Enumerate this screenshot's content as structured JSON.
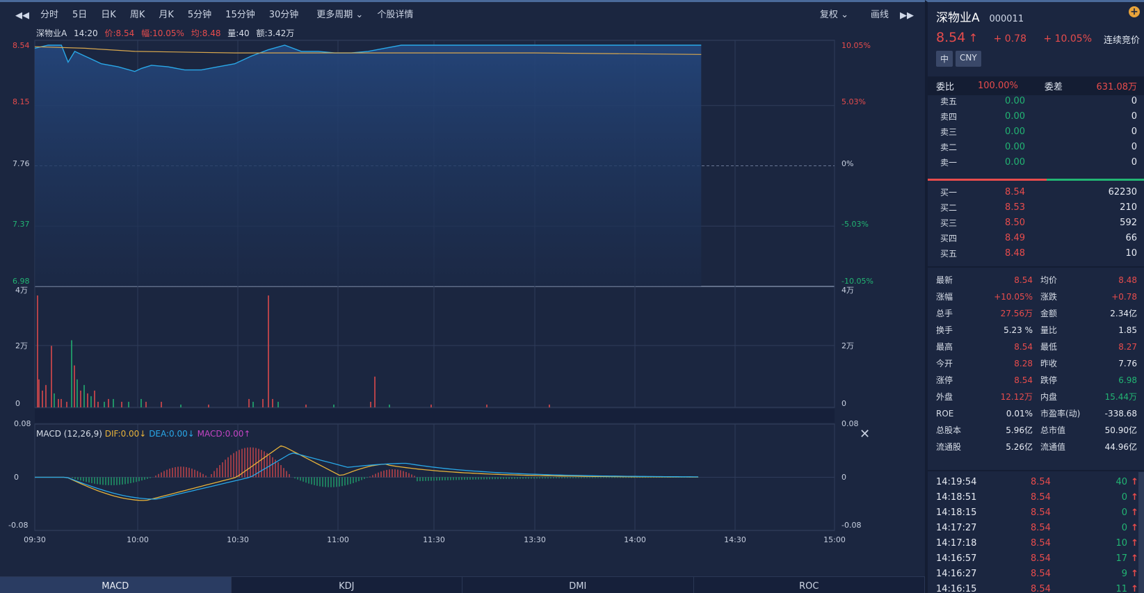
{
  "toolbar": {
    "prev_icon": "double-left-arrow",
    "items": [
      "分时",
      "5日",
      "日K",
      "周K",
      "月K",
      "5分钟",
      "15分钟",
      "30分钟",
      "更多周期",
      "个股详情"
    ],
    "active_index": 0,
    "fuquan": "复权",
    "draw": "画线",
    "next_icon": "double-right-arrow"
  },
  "info": {
    "name": "深物业A",
    "time": "14:20",
    "price": "价:8.54",
    "range": "幅:10.05%",
    "avg": "均:8.48",
    "vol": "量:40",
    "amount": "额:3.42万"
  },
  "axes": {
    "price_left": [
      "8.54",
      "8.15",
      "7.76",
      "7.37",
      "6.98"
    ],
    "pct_right": [
      "10.05%",
      "5.03%",
      "0%",
      "-5.03%",
      "-10.05%"
    ],
    "vol_left": [
      "4万",
      "2万",
      "0"
    ],
    "vol_right": [
      "4万",
      "2万",
      "0"
    ],
    "macd_left": [
      "0.08",
      "0",
      "-0.08"
    ],
    "macd_right": [
      "0.08",
      "0",
      "-0.08"
    ],
    "time": [
      "09:30",
      "10:00",
      "10:30",
      "11:00",
      "11:30",
      "13:30",
      "14:00",
      "14:30",
      "15:00"
    ]
  },
  "macd": {
    "title": "MACD (12,26,9)",
    "dif": "DIF:0.00↓",
    "dea": "DEA:0.00↓",
    "macd": "MACD:0.00↑",
    "close_icon": "close-icon"
  },
  "bottom_tabs": [
    "MACD",
    "KDJ",
    "DMI",
    "ROC"
  ],
  "colors": {
    "up": "#e84c4c",
    "down": "#22b573",
    "price_line": "#29a8e8",
    "avg_line": "#d9a84e",
    "macd_purple": "#c445c4"
  },
  "panel": {
    "name": "深物业A",
    "code": "000011",
    "price": "8.54",
    "arrow": "↑",
    "change": "+ 0.78",
    "change_pct": "+ 10.05%",
    "mode": "连续竞价",
    "badges": [
      "中",
      "CNY"
    ],
    "weibi_label": "委比",
    "weibi": "100.00%",
    "weicha_label": "委差",
    "weicha": "631.08万",
    "sell": [
      {
        "label": "卖五",
        "price": "0.00",
        "vol": "0"
      },
      {
        "label": "卖四",
        "price": "0.00",
        "vol": "0"
      },
      {
        "label": "卖三",
        "price": "0.00",
        "vol": "0"
      },
      {
        "label": "卖二",
        "price": "0.00",
        "vol": "0"
      },
      {
        "label": "卖一",
        "price": "0.00",
        "vol": "0"
      }
    ],
    "buy": [
      {
        "label": "买一",
        "price": "8.54",
        "vol": "62230"
      },
      {
        "label": "买二",
        "price": "8.53",
        "vol": "210"
      },
      {
        "label": "买三",
        "price": "8.50",
        "vol": "592"
      },
      {
        "label": "买四",
        "price": "8.49",
        "vol": "66"
      },
      {
        "label": "买五",
        "price": "8.48",
        "vol": "10"
      }
    ],
    "stats": [
      {
        "k1": "最新",
        "v1": "8.54",
        "c1": "red",
        "k2": "均价",
        "v2": "8.48",
        "c2": "red"
      },
      {
        "k1": "涨幅",
        "v1": "+10.05%",
        "c1": "red",
        "k2": "涨跌",
        "v2": "+0.78",
        "c2": "red"
      },
      {
        "k1": "总手",
        "v1": "27.56万",
        "c1": "red",
        "k2": "金额",
        "v2": "2.34亿",
        "c2": "white"
      },
      {
        "k1": "换手",
        "v1": "5.23 %",
        "c1": "white",
        "k2": "量比",
        "v2": "1.85",
        "c2": "white"
      },
      {
        "k1": "最高",
        "v1": "8.54",
        "c1": "red",
        "k2": "最低",
        "v2": "8.27",
        "c2": "red"
      },
      {
        "k1": "今开",
        "v1": "8.28",
        "c1": "red",
        "k2": "昨收",
        "v2": "7.76",
        "c2": "white"
      },
      {
        "k1": "涨停",
        "v1": "8.54",
        "c1": "red",
        "k2": "跌停",
        "v2": "6.98",
        "c2": "green"
      },
      {
        "k1": "外盘",
        "v1": "12.12万",
        "c1": "red",
        "k2": "内盘",
        "v2": "15.44万",
        "c2": "green"
      },
      {
        "k1": "ROE",
        "v1": "0.01%",
        "c1": "white",
        "k2": "市盈率(动)",
        "v2": "-338.68",
        "c2": "white"
      },
      {
        "k1": "总股本",
        "v1": "5.96亿",
        "c1": "white",
        "k2": "总市值",
        "v2": "50.90亿",
        "c2": "white"
      },
      {
        "k1": "流通股",
        "v1": "5.26亿",
        "c1": "white",
        "k2": "流通值",
        "v2": "44.96亿",
        "c2": "white"
      }
    ],
    "trades": [
      {
        "time": "14:19:54",
        "price": "8.54",
        "vol": "40",
        "vc": "green"
      },
      {
        "time": "14:18:51",
        "price": "8.54",
        "vol": "0",
        "vc": "green"
      },
      {
        "time": "14:18:15",
        "price": "8.54",
        "vol": "0",
        "vc": "green"
      },
      {
        "time": "14:17:27",
        "price": "8.54",
        "vol": "0",
        "vc": "green"
      },
      {
        "time": "14:17:18",
        "price": "8.54",
        "vol": "10",
        "vc": "green"
      },
      {
        "time": "14:16:57",
        "price": "8.54",
        "vol": "17",
        "vc": "green"
      },
      {
        "time": "14:16:27",
        "price": "8.54",
        "vol": "9",
        "vc": "green"
      },
      {
        "time": "14:16:15",
        "price": "8.54",
        "vol": "11",
        "vc": "green"
      }
    ]
  },
  "chart_data": {
    "type": "line",
    "price_series": {
      "t": [
        "09:30",
        "09:34",
        "09:38",
        "09:40",
        "09:42",
        "09:45",
        "09:48",
        "09:50",
        "09:55",
        "10:00",
        "10:02",
        "10:05",
        "10:10",
        "10:15",
        "10:20",
        "10:25",
        "10:30",
        "10:35",
        "10:40",
        "10:45",
        "10:50",
        "10:55",
        "11:00",
        "11:05",
        "11:10",
        "11:15",
        "11:20",
        "11:25",
        "11:30",
        "13:00",
        "13:30",
        "14:00",
        "14:20"
      ],
      "v": [
        8.52,
        8.54,
        8.54,
        8.43,
        8.5,
        8.47,
        8.44,
        8.42,
        8.4,
        8.37,
        8.39,
        8.41,
        8.4,
        8.38,
        8.38,
        8.4,
        8.42,
        8.47,
        8.51,
        8.54,
        8.5,
        8.5,
        8.49,
        8.49,
        8.5,
        8.52,
        8.54,
        8.54,
        8.54,
        8.54,
        8.54,
        8.54,
        8.54
      ]
    },
    "avg_series": {
      "t": [
        "09:30",
        "09:45",
        "10:00",
        "10:30",
        "11:00",
        "11:30",
        "13:30",
        "14:20"
      ],
      "v": [
        8.53,
        8.52,
        8.5,
        8.49,
        8.49,
        8.49,
        8.49,
        8.48
      ]
    },
    "ylim": [
      6.98,
      8.54
    ],
    "pre_close": 7.76
  }
}
